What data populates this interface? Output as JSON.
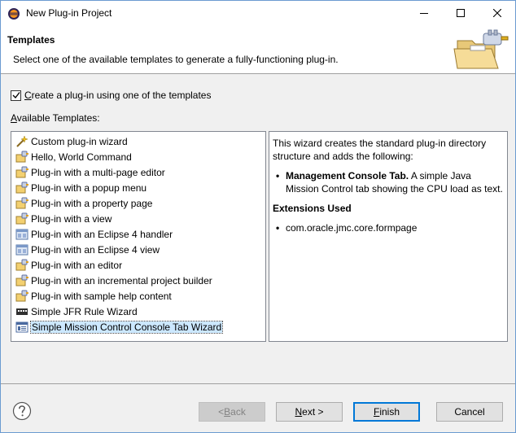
{
  "window": {
    "title": "New Plug-in Project"
  },
  "banner": {
    "title": "Templates",
    "description": "Select one of the available templates to generate a fully-functioning plug-in."
  },
  "options": {
    "use_template_prefix": "C",
    "use_template_rest": "reate a plug-in using one of the templates",
    "use_template_checked": true,
    "available_prefix": "A",
    "available_rest": "vailable Templates:"
  },
  "templates": [
    {
      "label": "Custom plug-in wizard",
      "icon": "wand-icon"
    },
    {
      "label": "Hello, World Command",
      "icon": "plugin-icon"
    },
    {
      "label": "Plug-in with a multi-page editor",
      "icon": "plugin-icon"
    },
    {
      "label": "Plug-in with a popup menu",
      "icon": "plugin-icon"
    },
    {
      "label": "Plug-in with a property page",
      "icon": "plugin-icon"
    },
    {
      "label": "Plug-in with a view",
      "icon": "plugin-icon"
    },
    {
      "label": "Plug-in with an Eclipse 4 handler",
      "icon": "e4-icon"
    },
    {
      "label": "Plug-in with an Eclipse 4 view",
      "icon": "e4-icon"
    },
    {
      "label": "Plug-in with an editor",
      "icon": "plugin-icon"
    },
    {
      "label": "Plug-in with an incremental project builder",
      "icon": "plugin-icon"
    },
    {
      "label": "Plug-in with sample help content",
      "icon": "plugin-icon"
    },
    {
      "label": "Simple JFR Rule Wizard",
      "icon": "jfr-icon"
    },
    {
      "label": "Simple Mission Control Console Tab Wizard",
      "icon": "console-tab-icon",
      "selected": true
    }
  ],
  "description": {
    "intro": "This wizard creates the standard plug-in directory structure and adds the following:",
    "bullet1_bold": "Management Console Tab.",
    "bullet1_text": " A simple Java Mission Control tab showing the CPU load as text.",
    "extensions_heading": "Extensions Used",
    "extension1": "com.oracle.jmc.core.formpage"
  },
  "buttons": {
    "back_prefix": "< ",
    "back_key": "B",
    "back_rest": "ack",
    "next_key": "N",
    "next_rest": "ext >",
    "finish_key": "F",
    "finish_rest": "inish",
    "cancel": "Cancel"
  },
  "colors": {
    "selection": "#cce8ff",
    "default_button_border": "#0078d7"
  }
}
